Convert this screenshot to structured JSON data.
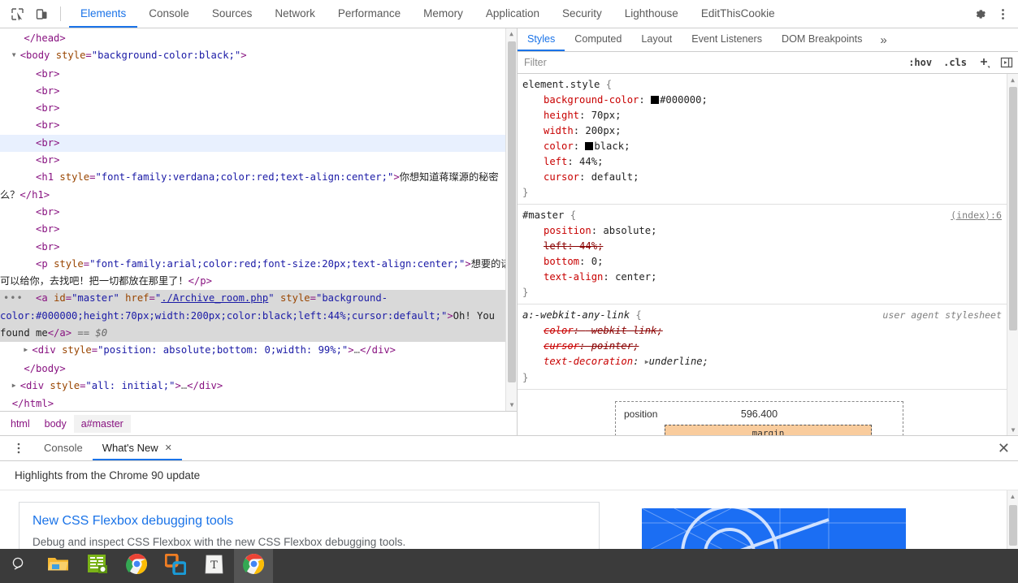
{
  "toolbar": {
    "icons": [
      {
        "name": "inspect-element-icon",
        "label": "Inspect element"
      },
      {
        "name": "device-toolbar-icon",
        "label": "Toggle device toolbar"
      }
    ],
    "tabs": [
      {
        "label": "Elements",
        "active": true
      },
      {
        "label": "Console",
        "active": false
      },
      {
        "label": "Sources",
        "active": false
      },
      {
        "label": "Network",
        "active": false
      },
      {
        "label": "Performance",
        "active": false
      },
      {
        "label": "Memory",
        "active": false
      },
      {
        "label": "Application",
        "active": false
      },
      {
        "label": "Security",
        "active": false
      },
      {
        "label": "Lighthouse",
        "active": false
      },
      {
        "label": "EditThisCookie",
        "active": false
      }
    ],
    "settings_icon": "gear-icon",
    "more_icon": "kebab-menu-icon",
    "accent_color": "#1a73e8"
  },
  "dom_tree": {
    "lines": [
      {
        "indent": 2,
        "html": "<span class=\"punct\">&lt;/head&gt;</span>"
      },
      {
        "indent": 0,
        "html": "<span class=\"twisty\">&#9660;</span><span class=\"punct\">&lt;</span><span class=\"tag\">body</span> <span class=\"attr\">style</span><span class=\"punct\">=</span><span class=\"val\">\"background-color:black;\"</span><span class=\"punct\">&gt;</span>"
      },
      {
        "indent": 4,
        "html": "<span class=\"punct\">&lt;</span><span class=\"tag\">br</span><span class=\"punct\">&gt;</span>"
      },
      {
        "indent": 4,
        "html": "<span class=\"punct\">&lt;</span><span class=\"tag\">br</span><span class=\"punct\">&gt;</span>"
      },
      {
        "indent": 4,
        "html": "<span class=\"punct\">&lt;</span><span class=\"tag\">br</span><span class=\"punct\">&gt;</span>"
      },
      {
        "indent": 4,
        "html": "<span class=\"punct\">&lt;</span><span class=\"tag\">br</span><span class=\"punct\">&gt;</span>"
      },
      {
        "indent": 4,
        "hovered": true,
        "html": "<span class=\"punct\">&lt;</span><span class=\"tag\">br</span><span class=\"punct\">&gt;</span>"
      },
      {
        "indent": 4,
        "html": "<span class=\"punct\">&lt;</span><span class=\"tag\">br</span><span class=\"punct\">&gt;</span>"
      },
      {
        "indent": 4,
        "html": "<span class=\"punct\">&lt;</span><span class=\"tag\">h1</span> <span class=\"attr\">style</span><span class=\"punct\">=</span><span class=\"val\">\"font-family:verdana;color:red;text-align:center;\"</span><span class=\"punct\">&gt;</span><span class=\"txt\">你想知道蒋璨源的秘密么？</span><span class=\"punct\">&lt;/</span><span class=\"tag\">h1</span><span class=\"punct\">&gt;</span>"
      },
      {
        "indent": 4,
        "html": "<span class=\"punct\">&lt;</span><span class=\"tag\">br</span><span class=\"punct\">&gt;</span>"
      },
      {
        "indent": 4,
        "html": "<span class=\"punct\">&lt;</span><span class=\"tag\">br</span><span class=\"punct\">&gt;</span>"
      },
      {
        "indent": 4,
        "html": "<span class=\"punct\">&lt;</span><span class=\"tag\">br</span><span class=\"punct\">&gt;</span>"
      },
      {
        "indent": 4,
        "html": "<span class=\"punct\">&lt;</span><span class=\"tag\">p</span> <span class=\"attr\">style</span><span class=\"punct\">=</span><span class=\"val\">\"font-family:arial;color:red;font-size:20px;text-align:center;\"</span><span class=\"punct\">&gt;</span><span class=\"txt\">想要的话可以给你，去找吧！把一切都放在那里了！</span><span class=\"punct\">&lt;/</span><span class=\"tag\">p</span><span class=\"punct\">&gt;</span>"
      },
      {
        "indent": 4,
        "selected": true,
        "dots": true,
        "html": "<span class=\"punct\">&lt;</span><span class=\"tag\">a</span> <span class=\"attr\">id</span><span class=\"punct\">=</span><span class=\"val\">\"master\"</span> <span class=\"attr\">href</span><span class=\"punct\">=</span><span class=\"val\">\"</span><span class=\"lnk\">./Archive_room.php</span><span class=\"val\">\"</span> <span class=\"attr\">style</span><span class=\"punct\">=</span><span class=\"val\">\"background-color:#000000;height:70px;width:200px;color:black;left:44%;cursor:default;\"</span><span class=\"punct\">&gt;</span><span class=\"txt\">Oh! You found me</span><span class=\"punct\">&lt;/</span><span class=\"tag\">a</span><span class=\"punct\">&gt;</span><span class=\"dollar\"> == $0</span>"
      },
      {
        "indent": 2,
        "html": "<span class=\"twisty\">&#9654;</span><span class=\"punct\">&lt;</span><span class=\"tag\">div</span> <span class=\"attr\">style</span><span class=\"punct\">=</span><span class=\"val\">\"position: absolute;bottom: 0;width: 99%;\"</span><span class=\"punct\">&gt;</span><span class=\"ellip\">…</span><span class=\"punct\">&lt;/</span><span class=\"tag\">div</span><span class=\"punct\">&gt;</span>"
      },
      {
        "indent": 2,
        "html": "<span class=\"punct\">&lt;/</span><span class=\"tag\">body</span><span class=\"punct\">&gt;</span>"
      },
      {
        "indent": 0,
        "html": "<span class=\"twisty\">&#9654;</span><span class=\"punct\">&lt;</span><span class=\"tag\">div</span> <span class=\"attr\">style</span><span class=\"punct\">=</span><span class=\"val\">\"all: initial;\"</span><span class=\"punct\">&gt;</span><span class=\"ellip\">…</span><span class=\"punct\">&lt;/</span><span class=\"tag\">div</span><span class=\"punct\">&gt;</span>"
      },
      {
        "indent": 0,
        "html": "<span class=\"punct\">&lt;/</span><span class=\"tag\">html</span><span class=\"punct\">&gt;</span>"
      }
    ]
  },
  "breadcrumb": {
    "items": [
      {
        "label": "html",
        "active": false
      },
      {
        "label": "body",
        "active": false
      },
      {
        "label": "a#master",
        "active": true
      }
    ]
  },
  "styles": {
    "tabs": [
      {
        "label": "Styles",
        "active": true
      },
      {
        "label": "Computed",
        "active": false
      },
      {
        "label": "Layout",
        "active": false
      },
      {
        "label": "Event Listeners",
        "active": false
      },
      {
        "label": "DOM Breakpoints",
        "active": false
      }
    ],
    "more_label": "»",
    "filter": {
      "placeholder": "Filter",
      "value": ""
    },
    "hov_label": ":hov",
    "cls_label": ".cls",
    "new_rule_label": "+",
    "sidebar_toggle_icon": "panel-toggle-icon",
    "rules": [
      {
        "selector": "element.style",
        "origin": "",
        "origin_is_link": false,
        "ua": false,
        "declarations": [
          {
            "prop": "background-color",
            "value": "#000000",
            "swatch": "#000000",
            "struck": false
          },
          {
            "prop": "height",
            "value": "70px",
            "struck": false
          },
          {
            "prop": "width",
            "value": "200px",
            "struck": false
          },
          {
            "prop": "color",
            "value": "black",
            "swatch": "#000000",
            "struck": false
          },
          {
            "prop": "left",
            "value": "44%",
            "struck": false
          },
          {
            "prop": "cursor",
            "value": "default",
            "struck": false
          }
        ]
      },
      {
        "selector": "#master",
        "origin": "(index):6",
        "origin_is_link": true,
        "ua": false,
        "declarations": [
          {
            "prop": "position",
            "value": "absolute",
            "struck": false
          },
          {
            "prop": "left",
            "value": "44%",
            "struck": true
          },
          {
            "prop": "bottom",
            "value": "0",
            "struck": false
          },
          {
            "prop": "text-align",
            "value": "center",
            "struck": false
          }
        ]
      },
      {
        "selector": "a:-webkit-any-link",
        "origin": "user agent stylesheet",
        "origin_is_link": false,
        "ua": true,
        "declarations": [
          {
            "prop": "color",
            "value": "-webkit-link",
            "struck": true
          },
          {
            "prop": "cursor",
            "value": "pointer",
            "struck": true
          },
          {
            "prop": "text-decoration",
            "value": "underline",
            "struck": false,
            "expandable": true
          }
        ]
      }
    ],
    "box_model": {
      "position_label": "position",
      "top_value": "596.400",
      "margin_label": "margin"
    }
  },
  "drawer": {
    "menu_icon": "kebab-menu-icon",
    "tabs": [
      {
        "label": "Console",
        "active": false,
        "closable": false
      },
      {
        "label": "What's New",
        "active": true,
        "closable": true
      }
    ],
    "close_label": "✕",
    "whats_new": {
      "heading": "Highlights from the Chrome 90 update",
      "card": {
        "title": "New CSS Flexbox debugging tools",
        "description": "Debug and inspect CSS Flexbox with the new CSS Flexbox debugging tools."
      }
    }
  },
  "taskbar": {
    "items": [
      {
        "name": "search-icon",
        "label": "Search",
        "active": false
      },
      {
        "name": "file-explorer-icon",
        "label": "File Explorer",
        "active": false
      },
      {
        "name": "notepad-app-icon",
        "label": "Editor",
        "active": false
      },
      {
        "name": "chrome-icon",
        "label": "Google Chrome",
        "active": false
      },
      {
        "name": "vmware-icon",
        "label": "VMware",
        "active": false
      },
      {
        "name": "text-editor-icon",
        "label": "Text editor",
        "active": false
      },
      {
        "name": "chrome-active-icon",
        "label": "Google Chrome",
        "active": true
      }
    ],
    "background_color": "#3b3b3b"
  }
}
